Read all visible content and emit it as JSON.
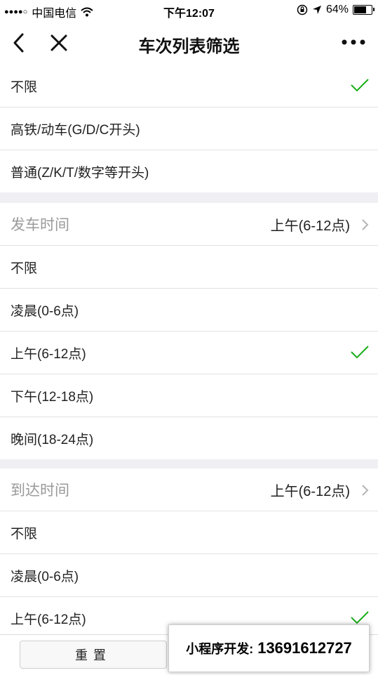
{
  "status_bar": {
    "signal": "●●●●○",
    "carrier": "中国电信",
    "time": "下午12:07",
    "battery": "64%"
  },
  "nav": {
    "title": "车次列表筛选"
  },
  "train_type": {
    "options": [
      "不限",
      "高铁/动车(G/D/C开头)",
      "普通(Z/K/T/数字等开头)"
    ],
    "selected_index": 0
  },
  "departure": {
    "header": "发车时间",
    "value": "上午(6-12点)",
    "options": [
      "不限",
      "凌晨(0-6点)",
      "上午(6-12点)",
      "下午(12-18点)",
      "晚间(18-24点)"
    ],
    "selected_index": 2
  },
  "arrival": {
    "header": "到达时间",
    "value": "上午(6-12点)",
    "options": [
      "不限",
      "凌晨(0-6点)",
      "上午(6-12点)"
    ],
    "selected_index": 2
  },
  "bottom": {
    "reset_label": "重置"
  },
  "promo": {
    "label": "小程序开发:",
    "number": "13691612727"
  },
  "colors": {
    "check": "#1aad19",
    "divider": "#efeff4"
  }
}
